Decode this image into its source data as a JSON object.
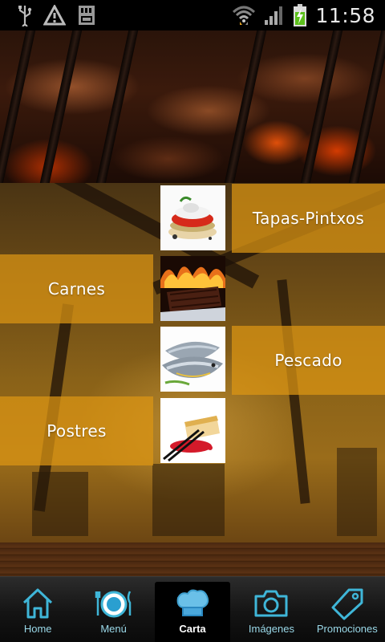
{
  "status_bar": {
    "time": "11:58",
    "icons": [
      "usb-icon",
      "warning-icon",
      "sd-card-icon",
      "wifi-icon",
      "signal-icon",
      "battery-charging-icon"
    ]
  },
  "hero": {
    "icon": "grill-image"
  },
  "categories": [
    {
      "label": "Tapas-Pintxos",
      "image": "tapas-image"
    },
    {
      "label": "Carnes",
      "image": "steak-image"
    },
    {
      "label": "Pescado",
      "image": "fish-image"
    },
    {
      "label": "Postres",
      "image": "dessert-image"
    }
  ],
  "tabs": [
    {
      "label": "Home",
      "icon": "home-icon",
      "active": false
    },
    {
      "label": "Menú",
      "icon": "dinner-plate-icon",
      "active": false
    },
    {
      "label": "Carta",
      "icon": "chef-hat-icon",
      "active": true
    },
    {
      "label": "Imágenes",
      "icon": "camera-icon",
      "active": false
    },
    {
      "label": "Promociones",
      "icon": "tag-icon",
      "active": false
    }
  ],
  "colors": {
    "band": "#dc9614",
    "tab_label": "#9ad8e8",
    "icon_outline": "#3fb6d8"
  }
}
